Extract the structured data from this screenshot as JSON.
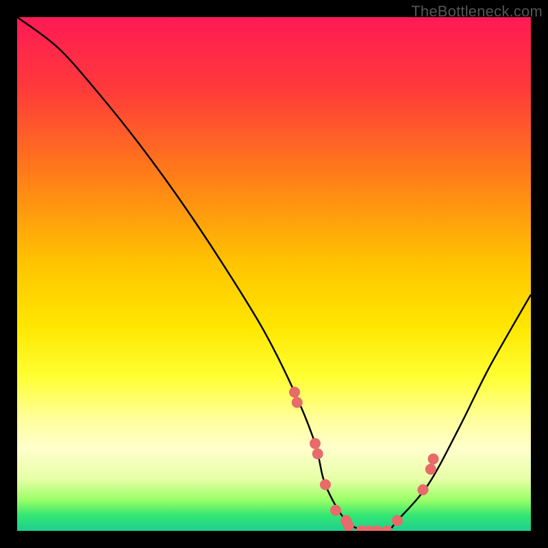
{
  "watermark": "TheBottleneck.com",
  "chart_data": {
    "type": "line",
    "title": "",
    "xlabel": "",
    "ylabel": "",
    "xlim": [
      0,
      100
    ],
    "ylim": [
      0,
      100
    ],
    "grid": false,
    "series": [
      {
        "name": "bottleneck-curve",
        "x": [
          0,
          8,
          16,
          24,
          32,
          40,
          48,
          54,
          58,
          60,
          64,
          68,
          72,
          74,
          80,
          86,
          92,
          100
        ],
        "values": [
          100,
          94,
          85,
          75,
          64,
          52,
          39,
          27,
          17,
          9,
          2,
          0,
          0,
          2,
          9,
          20,
          32,
          46
        ]
      }
    ],
    "dots": {
      "name": "highlighted-points",
      "color": "#e86a6a",
      "radius": 8,
      "x": [
        54,
        54.5,
        58,
        58.5,
        60,
        62,
        64,
        64.5,
        67,
        68.5,
        70,
        72,
        74,
        79,
        80.5,
        81
      ],
      "values": [
        27,
        25,
        17,
        15,
        9,
        4,
        2,
        1,
        0,
        0,
        0,
        0,
        2,
        8,
        12,
        14
      ]
    }
  }
}
